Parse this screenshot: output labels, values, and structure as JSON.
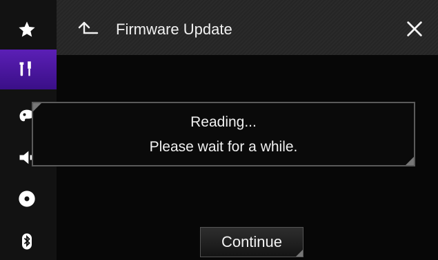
{
  "header": {
    "title": "Firmware Update"
  },
  "dialog": {
    "line1": "Reading...",
    "line2": "Please wait for a while."
  },
  "actions": {
    "continue_label": "Continue"
  },
  "sidebar": {
    "items": [
      {
        "icon": "star-icon"
      },
      {
        "icon": "settings-tools-icon",
        "active": true
      },
      {
        "icon": "palette-icon"
      },
      {
        "icon": "speaker-icon"
      },
      {
        "icon": "disc-icon"
      },
      {
        "icon": "bluetooth-icon"
      }
    ]
  },
  "colors": {
    "accent": "#4a1aa3"
  }
}
